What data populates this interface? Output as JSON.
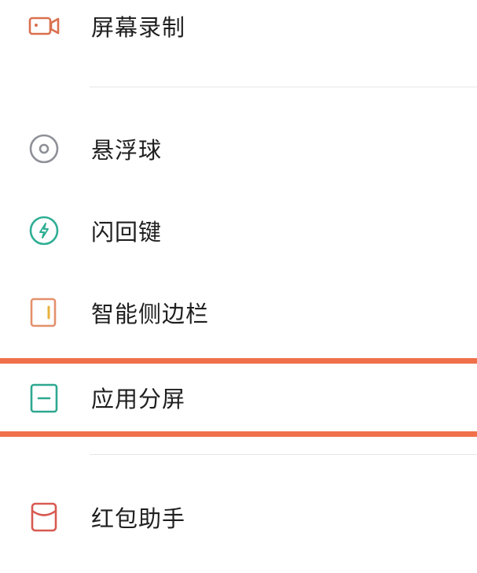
{
  "items": [
    {
      "label": "屏幕录制",
      "icon": "video-camera-icon"
    },
    {
      "label": "悬浮球",
      "icon": "floating-ball-icon"
    },
    {
      "label": "闪回键",
      "icon": "lightning-icon"
    },
    {
      "label": "智能侧边栏",
      "icon": "sidebar-icon"
    },
    {
      "label": "应用分屏",
      "icon": "split-screen-icon"
    },
    {
      "label": "红包助手",
      "icon": "red-envelope-icon"
    }
  ],
  "colors": {
    "highlight": "#f0704a",
    "divider": "#e6e6e6",
    "text": "#1f1f1f",
    "video_icon": "#d9704e",
    "ball_icon": "#8e9097",
    "lightning_icon": "#2eae94",
    "sidebar_icon_frame": "#e4906c",
    "sidebar_icon_bar": "#e9b23c",
    "split_icon": "#2ea890",
    "envelope_icon": "#d75a52"
  }
}
